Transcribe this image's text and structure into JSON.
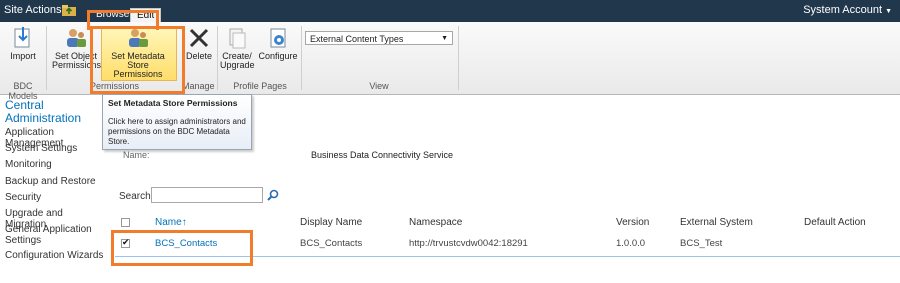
{
  "topbar": {
    "site_actions": "Site Actions",
    "tabs": [
      {
        "label": "Browse"
      },
      {
        "label": "Edit"
      }
    ],
    "account": "System Account"
  },
  "ribbon": {
    "buttons": {
      "import": "Import",
      "set_object_permissions": "Set Object Permissions",
      "set_metadata_store_permissions": "Set Metadata Store Permissions",
      "delete": "Delete",
      "create_upgrade": "Create/ Upgrade",
      "configure": "Configure"
    },
    "groups": {
      "bdc_models": "BDC Models",
      "permissions": "Permissions",
      "manage": "Manage",
      "profile_pages": "Profile Pages",
      "view": "View"
    },
    "view_select": "External Content Types"
  },
  "tooltip": {
    "title": "Set Metadata Store Permissions",
    "body": "Click here to assign administrators and permissions on the BDC Metadata Store."
  },
  "leftnav": {
    "heading": "Central Administration",
    "items": [
      "Application Management",
      "System Settings",
      "Monitoring",
      "Backup and Restore",
      "Security",
      "Upgrade and Migration",
      "General Application Settings",
      "Configuration Wizards"
    ]
  },
  "main": {
    "name_label": "Name:",
    "service": "Business Data Connectivity Service",
    "search_label": "Search",
    "table": {
      "headers": {
        "name": "Name",
        "display_name": "Display Name",
        "namespace": "Namespace",
        "version": "Version",
        "external_system": "External System",
        "default_action": "Default Action"
      },
      "rows": [
        {
          "name": "BCS_Contacts",
          "display_name": "BCS_Contacts",
          "namespace": "http://trvustcvdw0042:18291",
          "version": "1.0.0.0",
          "external_system": "BCS_Test",
          "default_action": ""
        }
      ]
    }
  },
  "colors": {
    "topbar": "#21374c",
    "link": "#0072bc",
    "callout": "#f07c2c"
  }
}
